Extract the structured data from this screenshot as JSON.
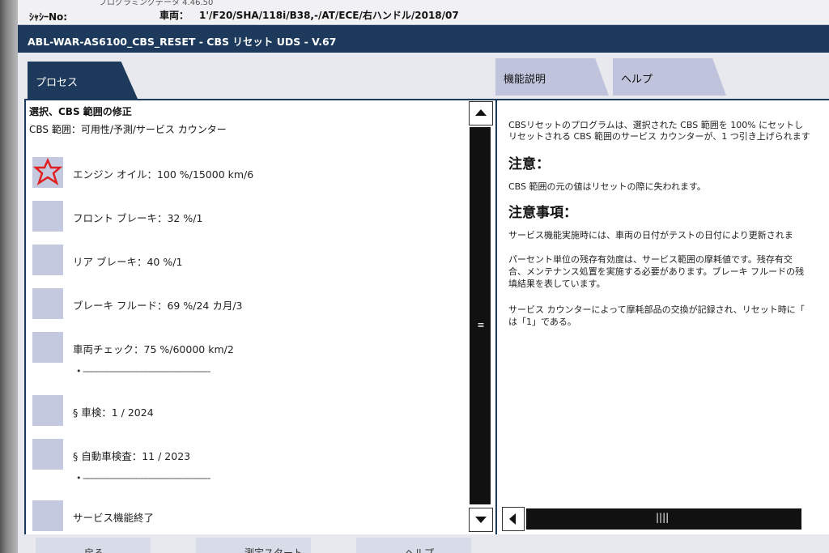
{
  "header": {
    "ghost_text": "プログラミングデータ  4.46.50",
    "chassis_label": "ｼｬｼｰNo:",
    "vehicle_label": "車両：",
    "vehicle_value": "1'/F20/SHA/118i/B38,-/AT/ECE/右ハンドル/2018/07"
  },
  "title": "ABL-WAR-AS6100_CBS_RESET - CBS リセット UDS - V.67",
  "tabs": {
    "process": "プロセス",
    "function": "機能説明",
    "help": "ヘルプ"
  },
  "left": {
    "heading": "選択、CBS 範囲の修正",
    "subheading": "CBS 範囲：可用性/予測/サービス カウンター",
    "items": [
      {
        "label": "エンジン オイル：100 %/15000 km/6",
        "icon": "warning-star-icon"
      },
      {
        "label": "フロント ブレーキ：32 %/1"
      },
      {
        "label": "リア ブレーキ：40 %/1"
      },
      {
        "label": "ブレーキ フルード：69 %/24 カ月/3"
      },
      {
        "label": "車両チェック：75 %/60000 km/2",
        "sub": "•  -----------------------------------------------------"
      },
      {
        "label": "§ 車検：1 / 2024"
      },
      {
        "label": "§ 自動車検査：11 / 2023",
        "sub": "•  -----------------------------------------------------"
      },
      {
        "label": "サービス機能終了"
      }
    ]
  },
  "right": {
    "intro1": "CBSリセットのプログラムは、選択された CBS 範囲を 100% にセットし",
    "intro2": "リセットされる CBS 範囲のサービス カウンターが、1 つ引き上げられます",
    "caution_heading": "注意：",
    "caution_text": "CBS 範囲の元の値はリセットの際に失われます。",
    "notes_heading": "注意事項：",
    "note1": "サービス機能実施時には、車両の日付がテストの日付により更新されま",
    "note2_l1": "パーセント単位の残存有効度は、サービス範囲の摩耗値です。残存有交",
    "note2_l2": "合、メンテナンス処置を実施する必要があります。ブレーキ フルードの残",
    "note2_l3": "填結果を表しています。",
    "note3_l1": "サービス カウンターによって摩耗部品の交換が記録され、リセット時に「",
    "note3_l2": "は「1」である。"
  },
  "bottom": {
    "btn1": "戻る",
    "btn2": "測定スタート",
    "btn3": "ヘルプ"
  },
  "colors": {
    "accent_navy": "#1d3a5c",
    "tab_lavender": "#bfc3db",
    "icon_box": "#c5c9df",
    "warning_red": "#e02020"
  }
}
